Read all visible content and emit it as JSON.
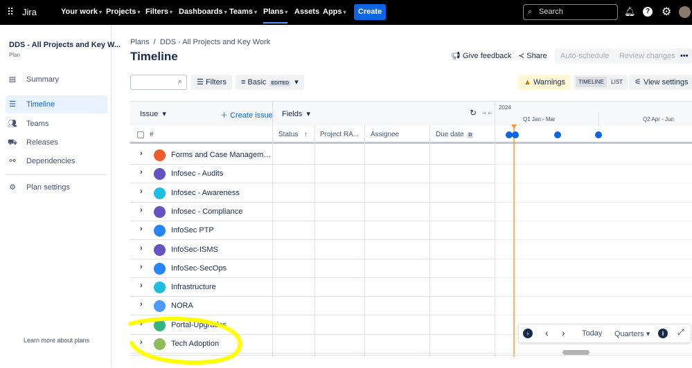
{
  "topnav": {
    "app": "Jira",
    "items": [
      "Your work",
      "Projects",
      "Filters",
      "Dashboards",
      "Teams",
      "Plans",
      "Assets",
      "Apps"
    ],
    "create": "Create",
    "search_placeholder": "Search"
  },
  "sidebar": {
    "plan_name": "DDS - All Projects and Key W...",
    "plan_type": "Plan",
    "items": [
      {
        "label": "Summary",
        "icon": "summary-icon"
      },
      {
        "label": "Timeline",
        "icon": "timeline-icon",
        "active": true
      },
      {
        "label": "Teams",
        "icon": "teams-icon"
      },
      {
        "label": "Releases",
        "icon": "releases-icon"
      },
      {
        "label": "Dependencies",
        "icon": "dependencies-icon"
      }
    ],
    "settings": "Plan settings",
    "learn_more": "Learn more about plans"
  },
  "header": {
    "breadcrumb": [
      "Plans",
      "DDS - All Projects and Key Work"
    ],
    "title": "Timeline",
    "give_feedback": "Give feedback",
    "share": "Share",
    "auto_schedule": "Auto-schedule",
    "review_changes": "Review changes"
  },
  "toolbar": {
    "filters": "Filters",
    "basic": "Basic",
    "edited": "EDITED",
    "warnings": "Warnings",
    "timeline": "TIMELINE",
    "list": "LIST",
    "view_settings": "View settings"
  },
  "table": {
    "issue": "Issue",
    "create_issue": "Create issue",
    "fields": "Fields",
    "hash": "#",
    "columns": [
      "Status",
      "Project RA...",
      "Assignee",
      "Due date"
    ],
    "due_tag": "D",
    "year": "2024",
    "quarters": [
      "Q1 Jan - Mar",
      "Q2 Apr - Jun"
    ],
    "rows": [
      {
        "name": "Forms and Case Manageme...",
        "color": "#f15a2b"
      },
      {
        "name": "Infosec - Audits",
        "color": "#6554c0"
      },
      {
        "name": "Infosec - Awareness",
        "color": "#1dbfe0"
      },
      {
        "name": "Infosec - Compliance",
        "color": "#6554c0"
      },
      {
        "name": "InfoSec PTP",
        "color": "#2684ff"
      },
      {
        "name": "InfoSec-ISMS",
        "color": "#6554c0"
      },
      {
        "name": "InfoSec-SecOps",
        "color": "#2684ff"
      },
      {
        "name": "Infrastructure",
        "color": "#1dbfe0"
      },
      {
        "name": "NORA",
        "color": "#4c9aff"
      },
      {
        "name": "Portal-Upgrades",
        "color": "#36b37e"
      },
      {
        "name": "Tech Adoption",
        "color": "#8fbc5a"
      }
    ]
  },
  "timeline_controls": {
    "today": "Today",
    "scale": "Quarters"
  },
  "colors": {
    "accent": "#0c66e4",
    "today_line": "#f79232",
    "highlight": "#ffff00"
  }
}
